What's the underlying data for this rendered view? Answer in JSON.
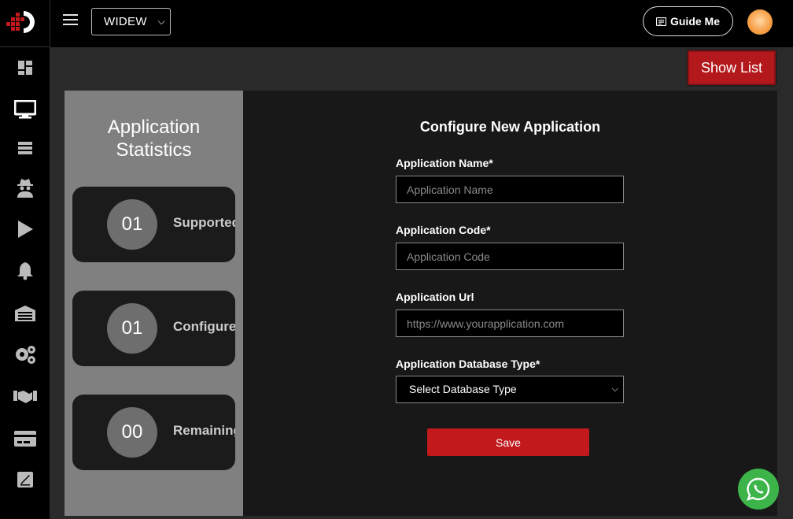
{
  "brand": {
    "logo_icon": "brand-logo-icon"
  },
  "sidebar": {
    "items": [
      {
        "name": "dashboard",
        "icon": "dashboard-icon"
      },
      {
        "name": "applications",
        "icon": "monitor-icon",
        "active": true
      },
      {
        "name": "database",
        "icon": "server-icon"
      },
      {
        "name": "agents",
        "icon": "spy-icon"
      },
      {
        "name": "run",
        "icon": "play-icon"
      },
      {
        "name": "notifications",
        "icon": "bell-icon"
      },
      {
        "name": "warehouse",
        "icon": "warehouse-icon"
      },
      {
        "name": "settings",
        "icon": "gears-icon"
      },
      {
        "name": "partners",
        "icon": "handshake-icon"
      },
      {
        "name": "billing",
        "icon": "credit-card-icon"
      },
      {
        "name": "reports",
        "icon": "signature-icon"
      }
    ]
  },
  "topbar": {
    "org_selected": "WIDEW",
    "guide_label": "Guide Me"
  },
  "content": {
    "show_list_label": "Show List",
    "stats": {
      "title_line1": "Application",
      "title_line2": "Statistics",
      "cards": [
        {
          "value": "01",
          "label": "Supported"
        },
        {
          "value": "01",
          "label": "Configured"
        },
        {
          "value": "00",
          "label": "Remaining"
        }
      ]
    },
    "form": {
      "title": "Configure New Application",
      "name_label": "Application Name*",
      "name_placeholder": "Application Name",
      "code_label": "Application Code*",
      "code_placeholder": "Application Code",
      "url_label": "Application Url",
      "url_placeholder": "https://www.yourapplication.com",
      "db_label": "Application Database Type*",
      "db_selected": "Select Database Type",
      "save_label": "Save"
    }
  },
  "colors": {
    "accent": "#c1191c",
    "stats_bg": "#808080",
    "whatsapp": "#3cb44a"
  }
}
